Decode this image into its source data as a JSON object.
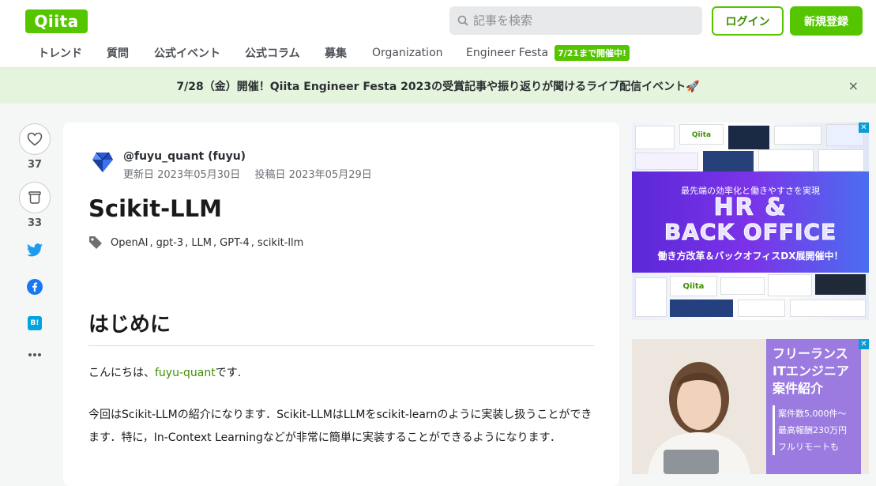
{
  "header": {
    "logo": "Qiita",
    "search_placeholder": "記事を検索",
    "login_label": "ログイン",
    "signup_label": "新規登録",
    "nav": [
      "トレンド",
      "質問",
      "公式イベント",
      "公式コラム",
      "募集",
      "Organization",
      "Engineer Festa"
    ],
    "festa_badge": "7/21まで開催中!"
  },
  "banner": {
    "text": "7/28（金）開催！Qiita Engineer Festa 2023の受賞記事や振り返りが聞けるライブ配信イベント🚀",
    "close": "×"
  },
  "sidebar": {
    "likes": "37",
    "stocks": "33",
    "share_icons": [
      "twitter-icon",
      "facebook-icon",
      "hatena-bookmark-icon",
      "more-icon"
    ],
    "hatena_label": "B!"
  },
  "article": {
    "author": "@fuyu_quant (fuyu)",
    "updated": "更新日 2023年05月30日",
    "posted": "投稿日 2023年05月29日",
    "title": "Scikit-LLM",
    "tags": [
      "OpenAI",
      "gpt-3",
      "LLM",
      "GPT-4",
      "scikit-llm"
    ],
    "heading": "はじめに",
    "p1_prefix": "こんにちは、",
    "p1_link": "fuyu-quant",
    "p1_suffix": "です.",
    "p2": "今回はScikit-LLMの紹介になります．Scikit-LLMはLLMをscikit-learnのように実装し扱うことができます．特に，In-Context Learningなどが非常に簡単に実装することができるようになります．"
  },
  "ads": {
    "ad1_top": "最先端の効率化と働きやすさを実現",
    "ad1_main1": "HR &",
    "ad1_main2": "BACK OFFICE",
    "ad1_sub": "働き方改革＆バックオフィスDX展開催中！",
    "ad1_qiita": "Qiita",
    "ad2_title1": "フリーランス",
    "ad2_title2": "ITエンジニア",
    "ad2_title3": "案件紹介",
    "ad2_points": [
      "案件数5,000件〜",
      "最高報酬230万円",
      "フルリモートも"
    ]
  },
  "colors": {
    "brand": "#55c500",
    "banner_bg": "#e5f4dc",
    "link": "#3f8f00",
    "twitter": "#1d9bf0",
    "facebook": "#1877f2",
    "hatena": "#00a4de"
  }
}
